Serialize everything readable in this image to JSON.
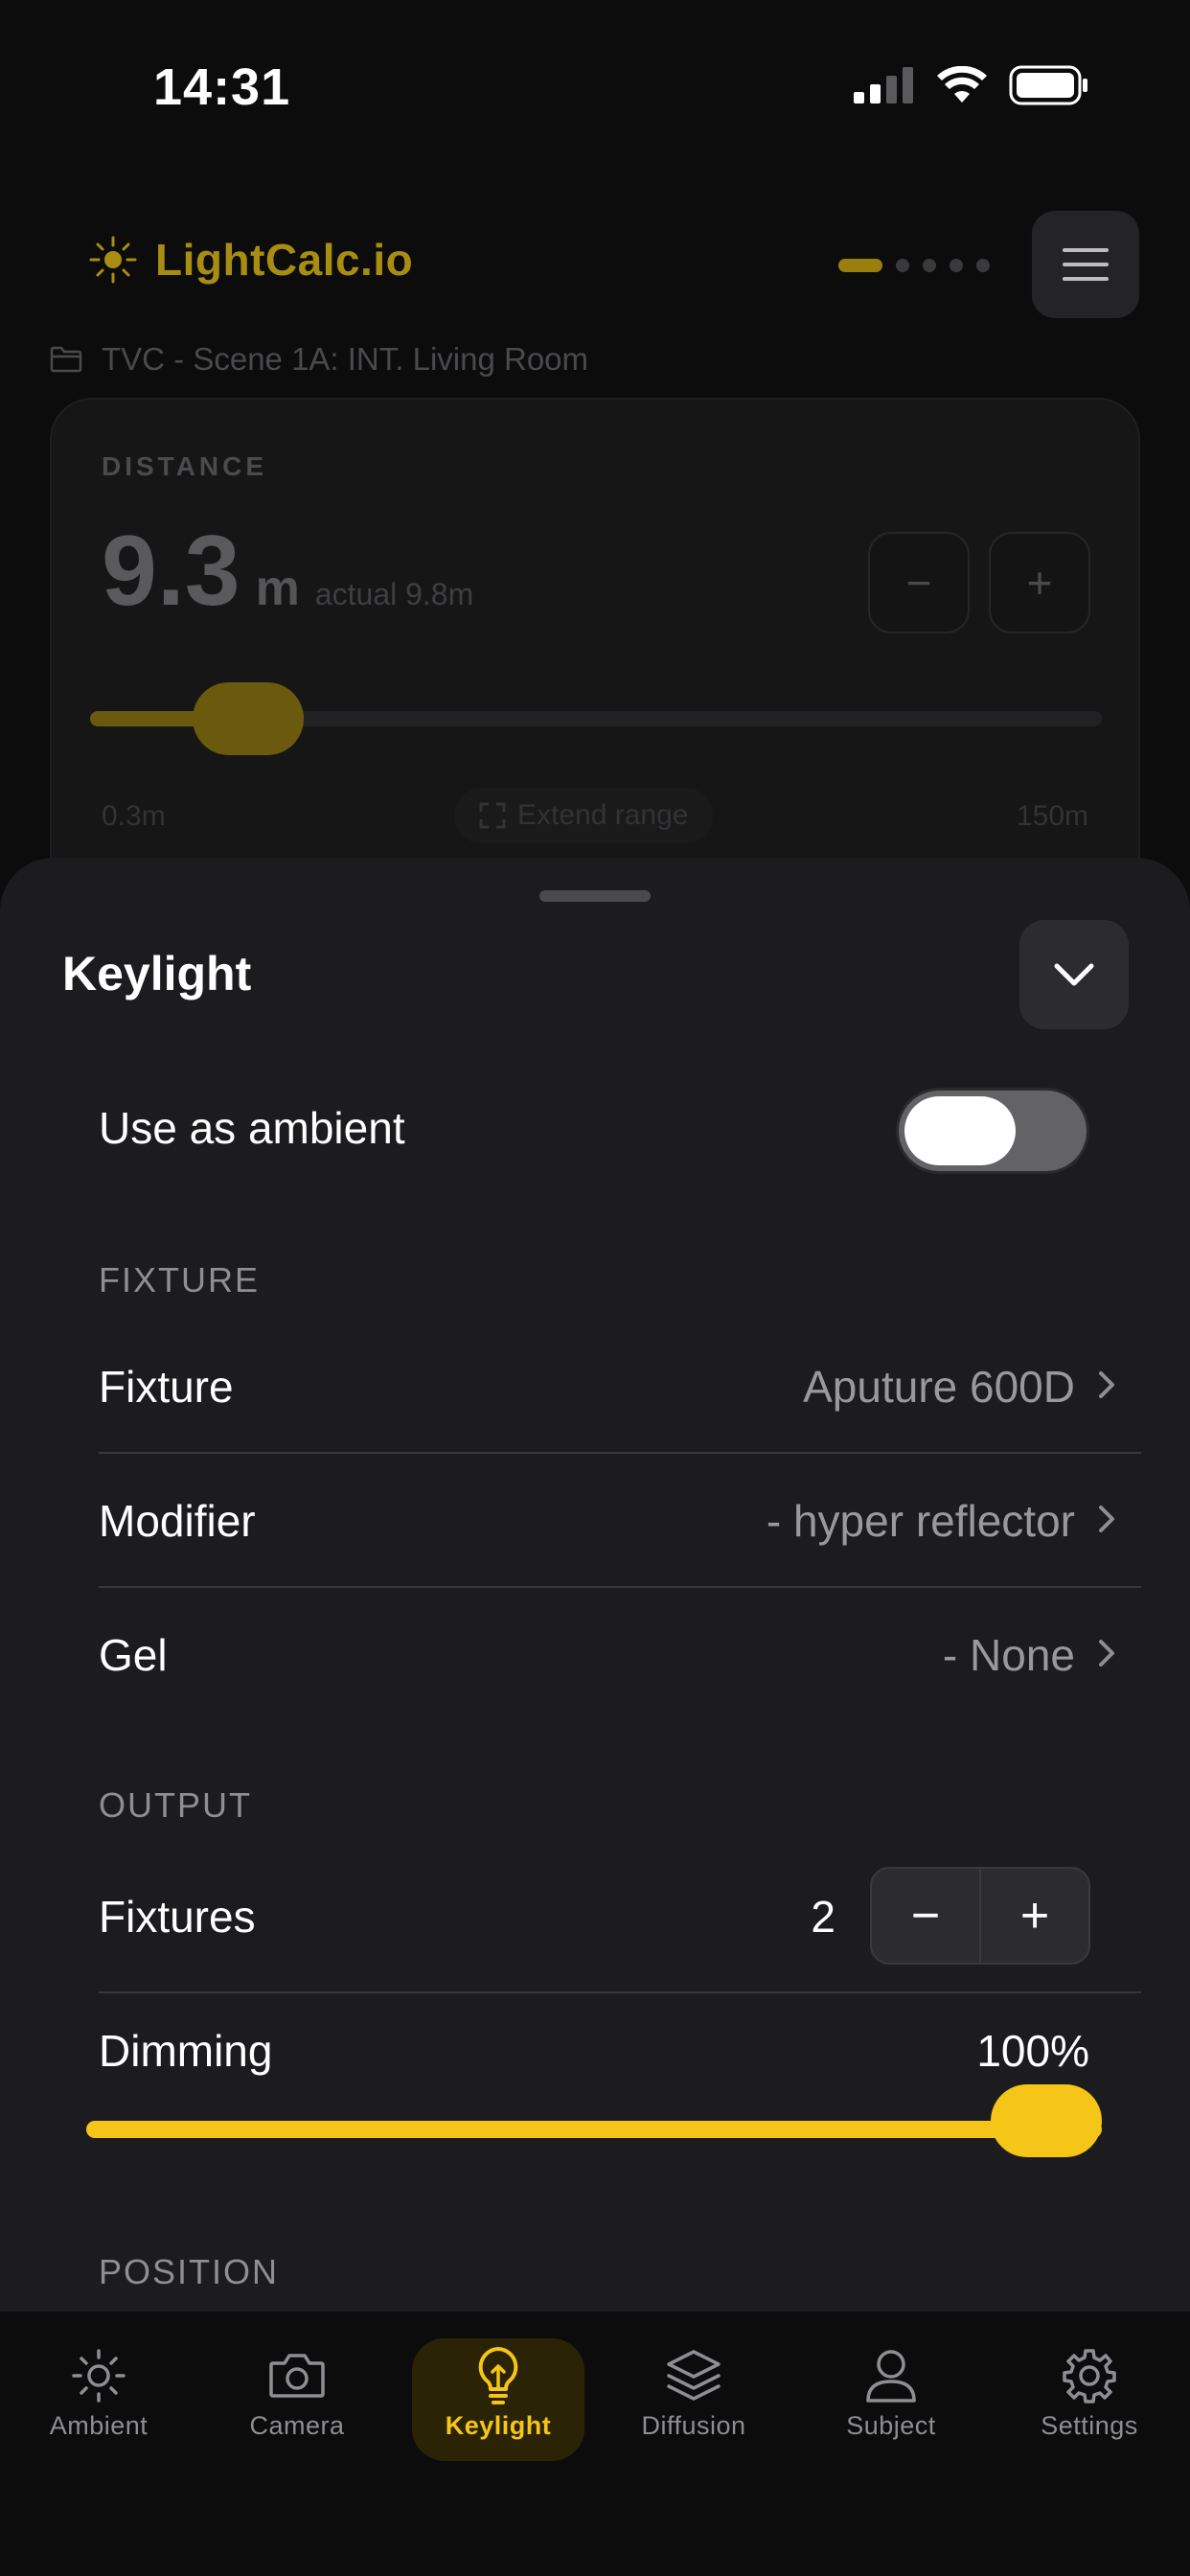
{
  "status_bar": {
    "time": "14:31"
  },
  "header": {
    "logo_text": "LightCalc.io",
    "menu_icon": "hamburger-icon"
  },
  "project": {
    "name": "TVC - Scene 1A: INT. Living Room",
    "icon": "folder-icon"
  },
  "distance_card": {
    "label": "DISTANCE",
    "value": "9.3",
    "unit": "m",
    "actual": "actual 9.8m",
    "minus": "−",
    "plus": "+",
    "slider_fraction": 0.06,
    "range_min": "0.3m",
    "range_max": "150m",
    "extend_label": "Extend range"
  },
  "sheet": {
    "title": "Keylight",
    "use_as_ambient": {
      "label": "Use as ambient",
      "on": false
    },
    "fixture_section": "FIXTURE",
    "fixture": {
      "label": "Fixture",
      "value": "Aputure 600D"
    },
    "modifier": {
      "label": "Modifier",
      "value": "- hyper reflector"
    },
    "gel": {
      "label": "Gel",
      "value": "- None"
    },
    "output_section": "OUTPUT",
    "fixtures": {
      "label": "Fixtures",
      "count": "2",
      "minus": "−",
      "plus": "+"
    },
    "dimming": {
      "label": "Dimming",
      "value": "100%",
      "fraction": 1.0
    },
    "position_section": "POSITION"
  },
  "tabs": [
    {
      "label": "Ambient",
      "icon": "sun-icon",
      "active": false
    },
    {
      "label": "Camera",
      "icon": "camera-icon",
      "active": false
    },
    {
      "label": "Keylight",
      "icon": "lightbulb-icon",
      "active": true
    },
    {
      "label": "Diffusion",
      "icon": "layers-icon",
      "active": false
    },
    {
      "label": "Subject",
      "icon": "person-icon",
      "active": false
    },
    {
      "label": "Settings",
      "icon": "gear-icon",
      "active": false
    }
  ],
  "colors": {
    "accent": "#f5c518",
    "sheet_bg": "#1c1c1e",
    "background": "#0c0c0d"
  }
}
